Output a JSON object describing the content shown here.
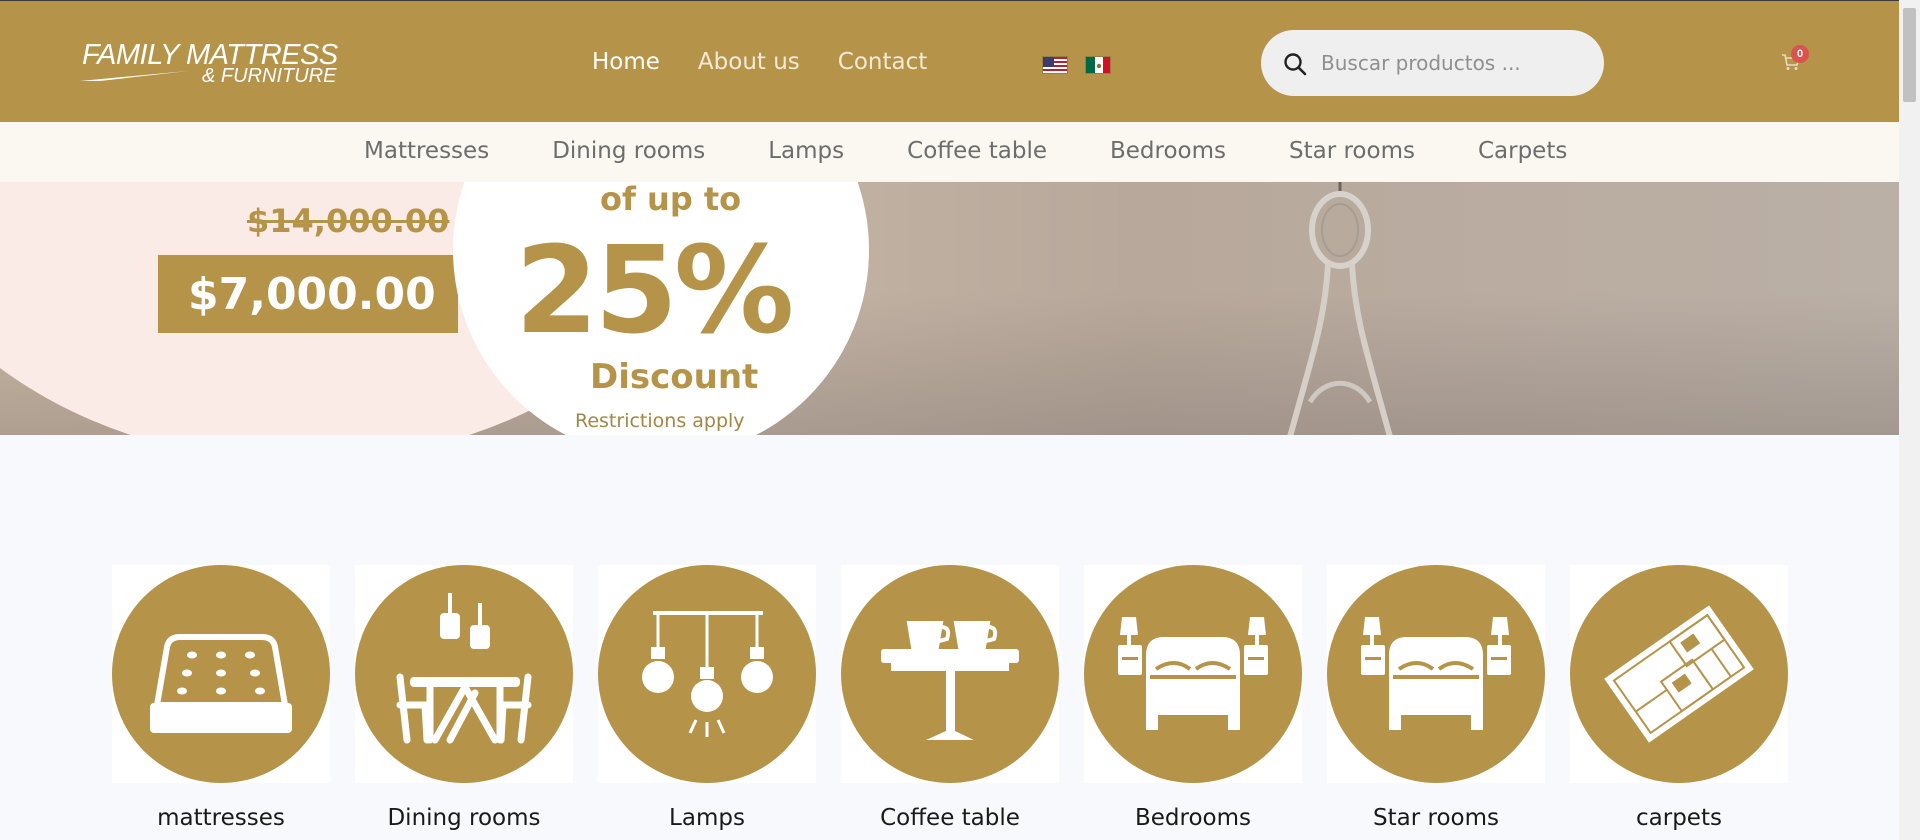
{
  "header": {
    "logo_line1": "FAMILY MATTRESS",
    "logo_line2": "& FURNITURE",
    "nav": [
      {
        "label": "Home"
      },
      {
        "label": "About us"
      },
      {
        "label": "Contact"
      }
    ],
    "languages": [
      "us-flag-icon",
      "mexico-flag-icon"
    ],
    "search": {
      "placeholder": "Buscar productos ..."
    },
    "cart": {
      "count": "0"
    }
  },
  "category_nav": [
    "Mattresses",
    "Dining rooms",
    "Lamps",
    "Coffee table",
    "Bedrooms",
    "Star rooms",
    "Carpets"
  ],
  "banner": {
    "old_price": "$14,000.00",
    "new_price": "$7,000.00",
    "up_to": "of up to",
    "discount_pct": "25%",
    "discount_label": "Discount",
    "note": "Restrictions apply"
  },
  "categories": [
    {
      "label": "mattresses",
      "icon": "mattress-icon"
    },
    {
      "label": "Dining rooms",
      "icon": "dining-room-icon"
    },
    {
      "label": "Lamps",
      "icon": "lamps-icon"
    },
    {
      "label": "Coffee table",
      "icon": "coffee-table-icon"
    },
    {
      "label": "Bedrooms",
      "icon": "bedroom-icon"
    },
    {
      "label": "Star rooms",
      "icon": "star-room-icon"
    },
    {
      "label": "carpets",
      "icon": "carpet-icon"
    }
  ],
  "colors": {
    "brand": "#b5944a",
    "subnav_bg": "#fbf8f1",
    "page_bg": "#f8f9fc"
  }
}
